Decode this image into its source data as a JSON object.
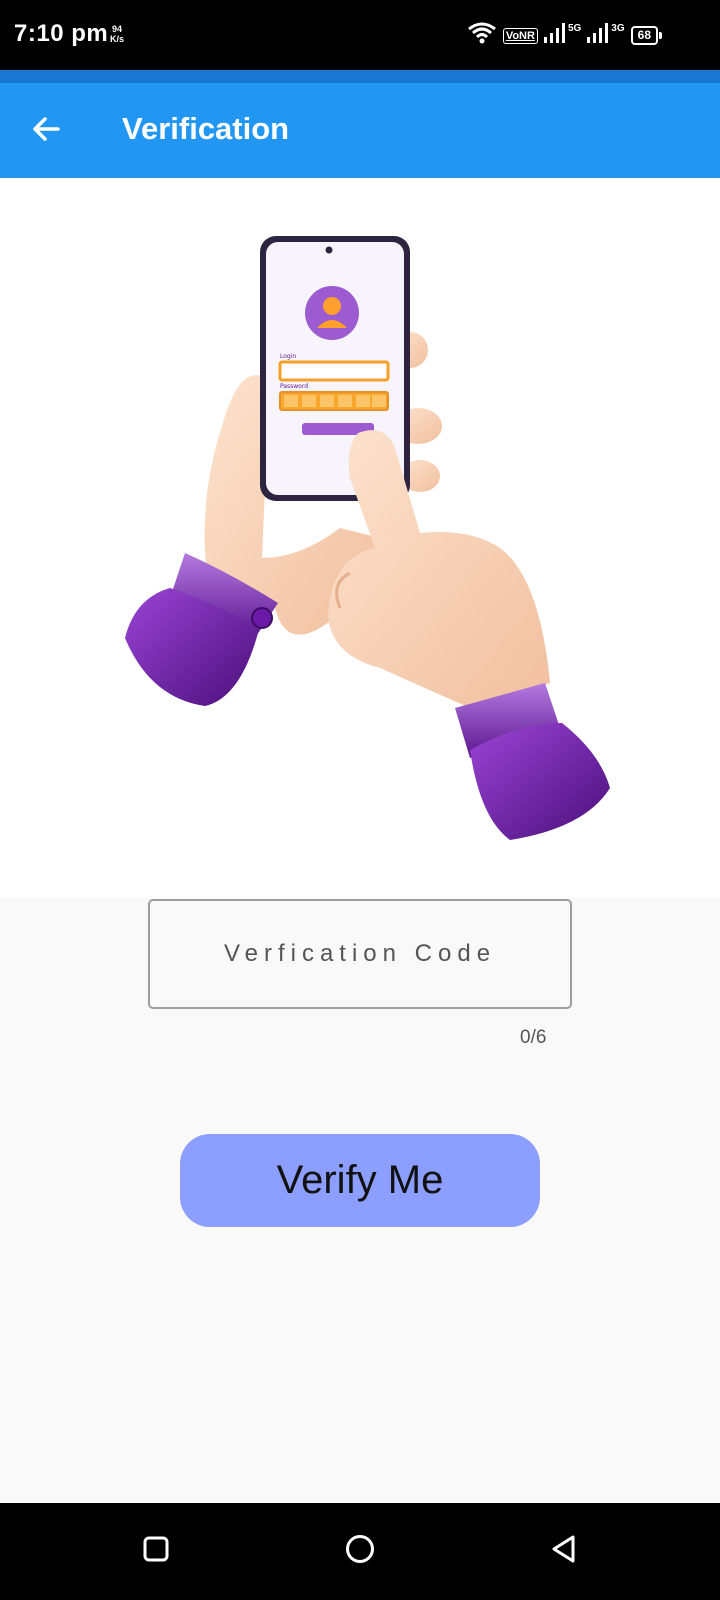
{
  "status_bar": {
    "time": "7:10 pm",
    "speed_value": "94",
    "speed_unit": "K/s",
    "vonr": "VoNR",
    "net1": "5G",
    "net2": "3G",
    "battery": "68"
  },
  "app_bar": {
    "title": "Verification",
    "back_icon": "arrow-left-icon",
    "color": "#2196f3"
  },
  "hero": {
    "illustration": "hands-holding-phone-login-illustration",
    "login_label": "Login",
    "password_label": "Password"
  },
  "form": {
    "code_placeholder": "Verfication Code",
    "counter": "0/6",
    "verify_label": "Verify Me",
    "button_color": "#8c9eff"
  },
  "nav_bar": {
    "recents_icon": "square-recents-icon",
    "home_icon": "circle-home-icon",
    "back_icon": "triangle-back-icon"
  }
}
